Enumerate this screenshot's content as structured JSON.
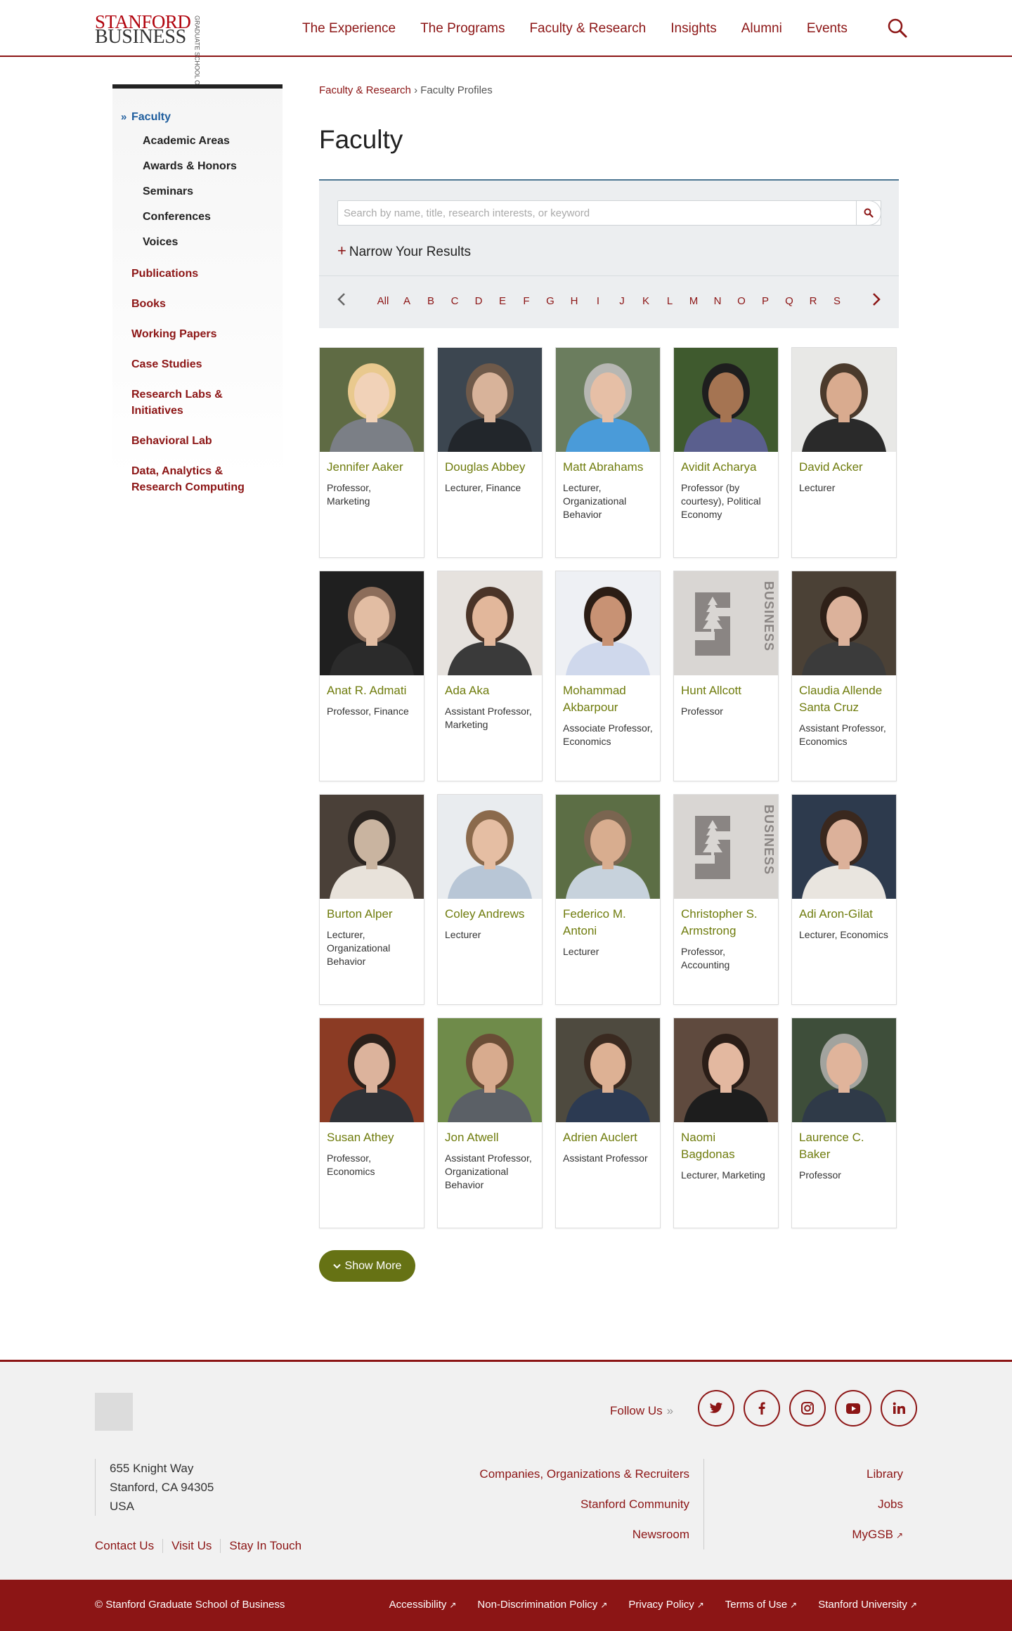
{
  "header": {
    "logo_main_1": "STANFORD",
    "logo_main_2": "BUSINESS",
    "logo_side": "GRADUATE SCHOOL OF",
    "nav": [
      "The Experience",
      "The Programs",
      "Faculty & Research",
      "Insights",
      "Alumni",
      "Events"
    ]
  },
  "sidebar": {
    "active": "Faculty",
    "sub": [
      "Academic Areas",
      "Awards & Honors",
      "Seminars",
      "Conferences",
      "Voices"
    ],
    "items": [
      "Publications",
      "Books",
      "Working Papers",
      "Case Studies",
      "Research Labs & Initiatives",
      "Behavioral Lab",
      "Data, Analytics & Research Computing"
    ]
  },
  "breadcrumb": {
    "parent": "Faculty & Research",
    "sep": "›",
    "current": "Faculty Profiles"
  },
  "page_title": "Faculty",
  "search": {
    "placeholder": "Search by name, title, research interests, or keyword",
    "narrow_label": "Narrow Your Results",
    "letters": [
      "All",
      "A",
      "B",
      "C",
      "D",
      "E",
      "F",
      "G",
      "H",
      "I",
      "J",
      "K",
      "L",
      "M",
      "N",
      "O",
      "P",
      "Q",
      "R",
      "S"
    ]
  },
  "faculty": [
    {
      "name": "Jennifer Aaker",
      "title": "Professor, Marketing",
      "photo": "portrait-woman-blonde"
    },
    {
      "name": "Douglas Abbey",
      "title": "Lecturer, Finance",
      "photo": "portrait-man-suit"
    },
    {
      "name": "Matt Abrahams",
      "title": "Lecturer, Organizational Behavior",
      "photo": "portrait-man-blue-sweater"
    },
    {
      "name": "Avidit Acharya",
      "title": "Professor (by courtesy), Political Economy",
      "photo": "portrait-man-glasses"
    },
    {
      "name": "David Acker",
      "title": "Lecturer",
      "photo": "portrait-man-beard"
    },
    {
      "name": "Anat R. Admati",
      "title": "Professor, Finance",
      "photo": "portrait-woman-dark"
    },
    {
      "name": "Ada Aka",
      "title": "Assistant Professor, Marketing",
      "photo": "portrait-woman-long-hair"
    },
    {
      "name": "Mohammad Akbarpour",
      "title": "Associate Professor, Economics",
      "photo": "portrait-man-curly"
    },
    {
      "name": "Hunt Allcott",
      "title": "Professor",
      "photo": "placeholder-logo"
    },
    {
      "name": "Claudia Allende Santa Cruz",
      "title": "Assistant Professor, Economics",
      "photo": "portrait-woman-brunette"
    },
    {
      "name": "Burton Alper",
      "title": "Lecturer, Organizational Behavior",
      "photo": "portrait-man-sepia"
    },
    {
      "name": "Coley Andrews",
      "title": "Lecturer",
      "photo": "portrait-man-light"
    },
    {
      "name": "Federico M. Antoni",
      "title": "Lecturer",
      "photo": "portrait-man-outdoor"
    },
    {
      "name": "Christopher S. Armstrong",
      "title": "Professor, Accounting",
      "photo": "placeholder-logo"
    },
    {
      "name": "Adi Aron-Gilat",
      "title": "Lecturer, Economics",
      "photo": "portrait-woman-navy"
    },
    {
      "name": "Susan Athey",
      "title": "Professor, Economics",
      "photo": "portrait-woman-library"
    },
    {
      "name": "Jon Atwell",
      "title": "Assistant Professor, Organizational Behavior",
      "photo": "portrait-man-green"
    },
    {
      "name": "Adrien Auclert",
      "title": "Assistant Professor",
      "photo": "portrait-man-young"
    },
    {
      "name": "Naomi Bagdonas",
      "title": "Lecturer, Marketing",
      "photo": "portrait-woman-smile"
    },
    {
      "name": "Laurence C. Baker",
      "title": "Professor",
      "photo": "portrait-man-gray"
    }
  ],
  "placeholder_logo_text": "BUSINESS",
  "show_more": "Show More",
  "footer": {
    "follow": "Follow Us",
    "social": [
      "twitter-icon",
      "facebook-icon",
      "instagram-icon",
      "youtube-icon",
      "linkedin-icon"
    ],
    "address": [
      "655 Knight Way",
      "Stanford, CA 94305",
      "USA"
    ],
    "links": [
      "Contact Us",
      "Visit Us",
      "Stay In Touch"
    ],
    "mid": [
      "Companies, Organizations & Recruiters",
      "Stanford Community",
      "Newsroom"
    ],
    "right": [
      "Library",
      "Jobs",
      "MyGSB"
    ],
    "copyright": "© Stanford Graduate School of Business",
    "legal": [
      "Accessibility",
      "Non-Discrimination Policy",
      "Privacy Policy",
      "Terms of Use",
      "Stanford University"
    ]
  },
  "colors": {
    "brand": "#8c1515",
    "name_green": "#6f7c0d",
    "button_green": "#667214",
    "active_blue": "#1f5e9e"
  }
}
